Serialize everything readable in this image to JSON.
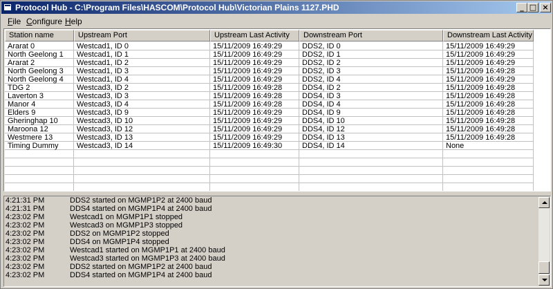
{
  "window": {
    "title": "Protocol Hub - C:\\Program Files\\HASCOM\\Protocol Hub\\Victorian Plains 1127.PHD",
    "buttons": {
      "minimize": "_",
      "maximize": "□",
      "close": "×"
    }
  },
  "menu": [
    {
      "label": "File",
      "accel": "F",
      "rest": "ile"
    },
    {
      "label": "Configure",
      "accel": "C",
      "rest": "onfigure"
    },
    {
      "label": "Help",
      "accel": "H",
      "rest": "elp"
    }
  ],
  "table": {
    "columns": [
      "Station name",
      "Upstream Port",
      "Upstream Last Activity",
      "Downstream Port",
      "Downstream Last Activity"
    ],
    "rows": [
      [
        "Ararat 0",
        "Westcad1, ID 0",
        "15/11/2009 16:49:29",
        "DDS2, ID 0",
        "15/11/2009 16:49:29"
      ],
      [
        "North Geelong 1",
        "Westcad1, ID 1",
        "15/11/2009 16:49:29",
        "DDS2, ID 1",
        "15/11/2009 16:49:29"
      ],
      [
        "Ararat 2",
        "Westcad1, ID 2",
        "15/11/2009 16:49:29",
        "DDS2, ID 2",
        "15/11/2009 16:49:29"
      ],
      [
        "North Geelong 3",
        "Westcad1, ID 3",
        "15/11/2009 16:49:29",
        "DDS2, ID 3",
        "15/11/2009 16:49:28"
      ],
      [
        "North Geelong 4",
        "Westcad1, ID 4",
        "15/11/2009 16:49:29",
        "DDS2, ID 4",
        "15/11/2009 16:49:29"
      ],
      [
        "TDG 2",
        "Westcad3, ID 2",
        "15/11/2009 16:49:28",
        "DDS4, ID 2",
        "15/11/2009 16:49:28"
      ],
      [
        "Laverton 3",
        "Westcad3, ID 3",
        "15/11/2009 16:49:28",
        "DDS4, ID 3",
        "15/11/2009 16:49:28"
      ],
      [
        "Manor 4",
        "Westcad3, ID 4",
        "15/11/2009 16:49:28",
        "DDS4, ID 4",
        "15/11/2009 16:49:28"
      ],
      [
        "Elders 9",
        "Westcad3, ID 9",
        "15/11/2009 16:49:29",
        "DDS4, ID 9",
        "15/11/2009 16:49:28"
      ],
      [
        "Gheringhap 10",
        "Westcad3, ID 10",
        "15/11/2009 16:49:29",
        "DDS4, ID 10",
        "15/11/2009 16:49:28"
      ],
      [
        "Maroona 12",
        "Westcad3, ID 12",
        "15/11/2009 16:49:29",
        "DDS4, ID 12",
        "15/11/2009 16:49:28"
      ],
      [
        "Westmere 13",
        "Westcad3, ID 13",
        "15/11/2009 16:49:29",
        "DDS4, ID 13",
        "15/11/2009 16:49:28"
      ],
      [
        "Timing Dummy",
        "Westcad3, ID 14",
        "15/11/2009 16:49:30",
        "DDS4, ID 14",
        "None"
      ]
    ]
  },
  "log": [
    {
      "time": "4:21:31 PM",
      "message": "DDS2 started on MGMP1P2 at 2400 baud"
    },
    {
      "time": "4:21:31 PM",
      "message": "DDS4 started on MGMP1P4 at 2400 baud"
    },
    {
      "time": "4:23:02 PM",
      "message": "Westcad1 on MGMP1P1 stopped"
    },
    {
      "time": "4:23:02 PM",
      "message": "Westcad3 on MGMP1P3 stopped"
    },
    {
      "time": "4:23:02 PM",
      "message": "DDS2 on MGMP1P2 stopped"
    },
    {
      "time": "4:23:02 PM",
      "message": "DDS4 on MGMP1P4 stopped"
    },
    {
      "time": "4:23:02 PM",
      "message": "Westcad1 started on MGMP1P1 at 2400 baud"
    },
    {
      "time": "4:23:02 PM",
      "message": "Westcad3 started on MGMP1P3 at 2400 baud"
    },
    {
      "time": "4:23:02 PM",
      "message": "DDS2 started on MGMP1P2 at 2400 baud"
    },
    {
      "time": "4:23:02 PM",
      "message": "DDS4 started on MGMP1P4 at 2400 baud"
    }
  ],
  "icons": {
    "app": "app-window-icon",
    "scroll_up": "scroll-up-arrow-icon",
    "scroll_down": "scroll-down-arrow-icon"
  },
  "colors": {
    "titlebar_start": "#0a246a",
    "titlebar_end": "#a6caf0",
    "face": "#d4d0c8"
  }
}
